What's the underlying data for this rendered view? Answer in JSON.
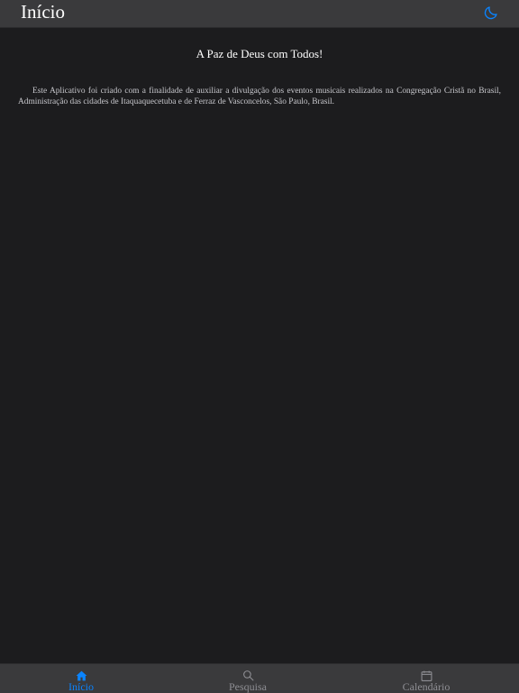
{
  "header": {
    "title": "Início",
    "theme_toggle_icon": "moon-icon"
  },
  "main": {
    "greeting": "A Paz de Deus com Todos!",
    "description": "Este Aplicativo foi criado com a finalidade de auxiliar a divulgação dos eventos musicais realizados na Congregação Cristã no Brasil, Administração das cidades de Itaquaquecetuba e de Ferraz de Vasconcelos, São Paulo, Brasil."
  },
  "tabbar": {
    "items": [
      {
        "label": "Início",
        "icon": "home-icon",
        "active": true
      },
      {
        "label": "Pesquisa",
        "icon": "search-icon",
        "active": false
      },
      {
        "label": "Calendário",
        "icon": "calendar-icon",
        "active": false
      }
    ]
  },
  "colors": {
    "background": "#1c1c1e",
    "bar": "#3a3a3c",
    "accent": "#0a84ff",
    "inactive": "#8e8e93"
  }
}
